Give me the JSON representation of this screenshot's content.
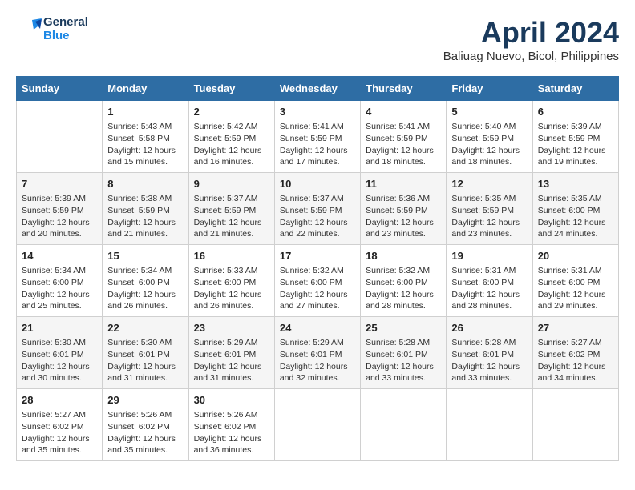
{
  "header": {
    "logo_line1": "General",
    "logo_line2": "Blue",
    "title": "April 2024",
    "subtitle": "Baliuag Nuevo, Bicol, Philippines"
  },
  "calendar": {
    "days_of_week": [
      "Sunday",
      "Monday",
      "Tuesday",
      "Wednesday",
      "Thursday",
      "Friday",
      "Saturday"
    ],
    "weeks": [
      [
        {
          "day": "",
          "info": ""
        },
        {
          "day": "1",
          "info": "Sunrise: 5:43 AM\nSunset: 5:58 PM\nDaylight: 12 hours\nand 15 minutes."
        },
        {
          "day": "2",
          "info": "Sunrise: 5:42 AM\nSunset: 5:59 PM\nDaylight: 12 hours\nand 16 minutes."
        },
        {
          "day": "3",
          "info": "Sunrise: 5:41 AM\nSunset: 5:59 PM\nDaylight: 12 hours\nand 17 minutes."
        },
        {
          "day": "4",
          "info": "Sunrise: 5:41 AM\nSunset: 5:59 PM\nDaylight: 12 hours\nand 18 minutes."
        },
        {
          "day": "5",
          "info": "Sunrise: 5:40 AM\nSunset: 5:59 PM\nDaylight: 12 hours\nand 18 minutes."
        },
        {
          "day": "6",
          "info": "Sunrise: 5:39 AM\nSunset: 5:59 PM\nDaylight: 12 hours\nand 19 minutes."
        }
      ],
      [
        {
          "day": "7",
          "info": "Sunrise: 5:39 AM\nSunset: 5:59 PM\nDaylight: 12 hours\nand 20 minutes."
        },
        {
          "day": "8",
          "info": "Sunrise: 5:38 AM\nSunset: 5:59 PM\nDaylight: 12 hours\nand 21 minutes."
        },
        {
          "day": "9",
          "info": "Sunrise: 5:37 AM\nSunset: 5:59 PM\nDaylight: 12 hours\nand 21 minutes."
        },
        {
          "day": "10",
          "info": "Sunrise: 5:37 AM\nSunset: 5:59 PM\nDaylight: 12 hours\nand 22 minutes."
        },
        {
          "day": "11",
          "info": "Sunrise: 5:36 AM\nSunset: 5:59 PM\nDaylight: 12 hours\nand 23 minutes."
        },
        {
          "day": "12",
          "info": "Sunrise: 5:35 AM\nSunset: 5:59 PM\nDaylight: 12 hours\nand 23 minutes."
        },
        {
          "day": "13",
          "info": "Sunrise: 5:35 AM\nSunset: 6:00 PM\nDaylight: 12 hours\nand 24 minutes."
        }
      ],
      [
        {
          "day": "14",
          "info": "Sunrise: 5:34 AM\nSunset: 6:00 PM\nDaylight: 12 hours\nand 25 minutes."
        },
        {
          "day": "15",
          "info": "Sunrise: 5:34 AM\nSunset: 6:00 PM\nDaylight: 12 hours\nand 26 minutes."
        },
        {
          "day": "16",
          "info": "Sunrise: 5:33 AM\nSunset: 6:00 PM\nDaylight: 12 hours\nand 26 minutes."
        },
        {
          "day": "17",
          "info": "Sunrise: 5:32 AM\nSunset: 6:00 PM\nDaylight: 12 hours\nand 27 minutes."
        },
        {
          "day": "18",
          "info": "Sunrise: 5:32 AM\nSunset: 6:00 PM\nDaylight: 12 hours\nand 28 minutes."
        },
        {
          "day": "19",
          "info": "Sunrise: 5:31 AM\nSunset: 6:00 PM\nDaylight: 12 hours\nand 28 minutes."
        },
        {
          "day": "20",
          "info": "Sunrise: 5:31 AM\nSunset: 6:00 PM\nDaylight: 12 hours\nand 29 minutes."
        }
      ],
      [
        {
          "day": "21",
          "info": "Sunrise: 5:30 AM\nSunset: 6:01 PM\nDaylight: 12 hours\nand 30 minutes."
        },
        {
          "day": "22",
          "info": "Sunrise: 5:30 AM\nSunset: 6:01 PM\nDaylight: 12 hours\nand 31 minutes."
        },
        {
          "day": "23",
          "info": "Sunrise: 5:29 AM\nSunset: 6:01 PM\nDaylight: 12 hours\nand 31 minutes."
        },
        {
          "day": "24",
          "info": "Sunrise: 5:29 AM\nSunset: 6:01 PM\nDaylight: 12 hours\nand 32 minutes."
        },
        {
          "day": "25",
          "info": "Sunrise: 5:28 AM\nSunset: 6:01 PM\nDaylight: 12 hours\nand 33 minutes."
        },
        {
          "day": "26",
          "info": "Sunrise: 5:28 AM\nSunset: 6:01 PM\nDaylight: 12 hours\nand 33 minutes."
        },
        {
          "day": "27",
          "info": "Sunrise: 5:27 AM\nSunset: 6:02 PM\nDaylight: 12 hours\nand 34 minutes."
        }
      ],
      [
        {
          "day": "28",
          "info": "Sunrise: 5:27 AM\nSunset: 6:02 PM\nDaylight: 12 hours\nand 35 minutes."
        },
        {
          "day": "29",
          "info": "Sunrise: 5:26 AM\nSunset: 6:02 PM\nDaylight: 12 hours\nand 35 minutes."
        },
        {
          "day": "30",
          "info": "Sunrise: 5:26 AM\nSunset: 6:02 PM\nDaylight: 12 hours\nand 36 minutes."
        },
        {
          "day": "",
          "info": ""
        },
        {
          "day": "",
          "info": ""
        },
        {
          "day": "",
          "info": ""
        },
        {
          "day": "",
          "info": ""
        }
      ]
    ]
  }
}
